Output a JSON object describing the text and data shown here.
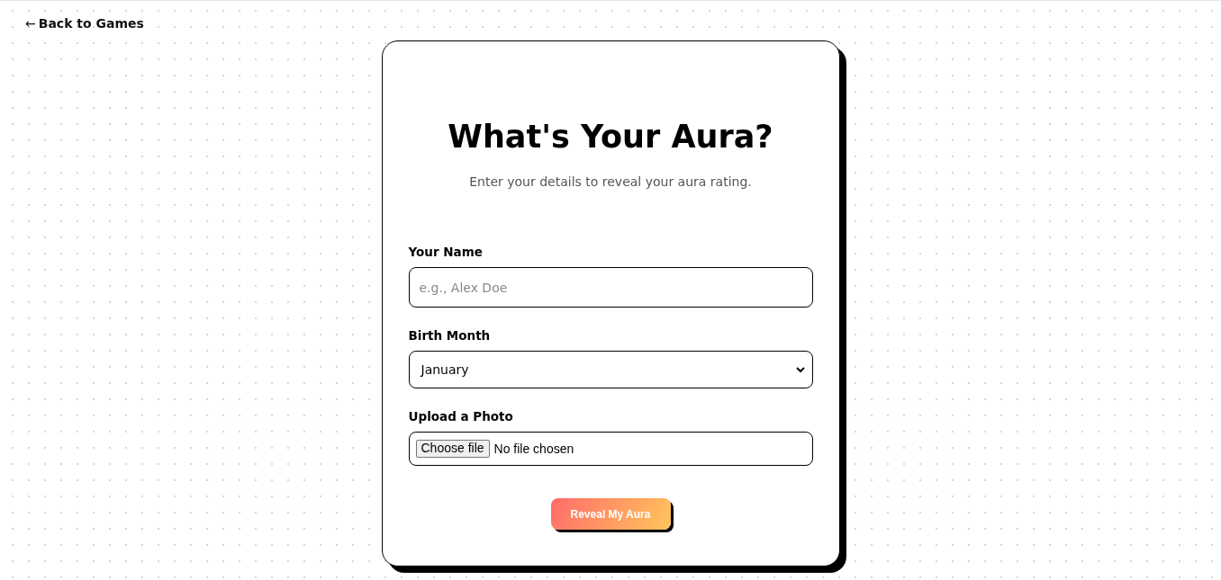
{
  "back_link": {
    "arrow": "←",
    "label": "Back to Games"
  },
  "card": {
    "title": "What's Your Aura?",
    "subtitle": "Enter your details to reveal your aura rating.",
    "fields": [
      {
        "kind": "text",
        "label": "Your Name",
        "placeholder": "e.g., Alex Doe"
      },
      {
        "kind": "select",
        "label": "Birth Month",
        "value": "January"
      },
      {
        "kind": "file",
        "label": "Upload a Photo",
        "button": "Choose file",
        "status": "No file chosen"
      }
    ],
    "submit": "Reveal My Aura"
  }
}
